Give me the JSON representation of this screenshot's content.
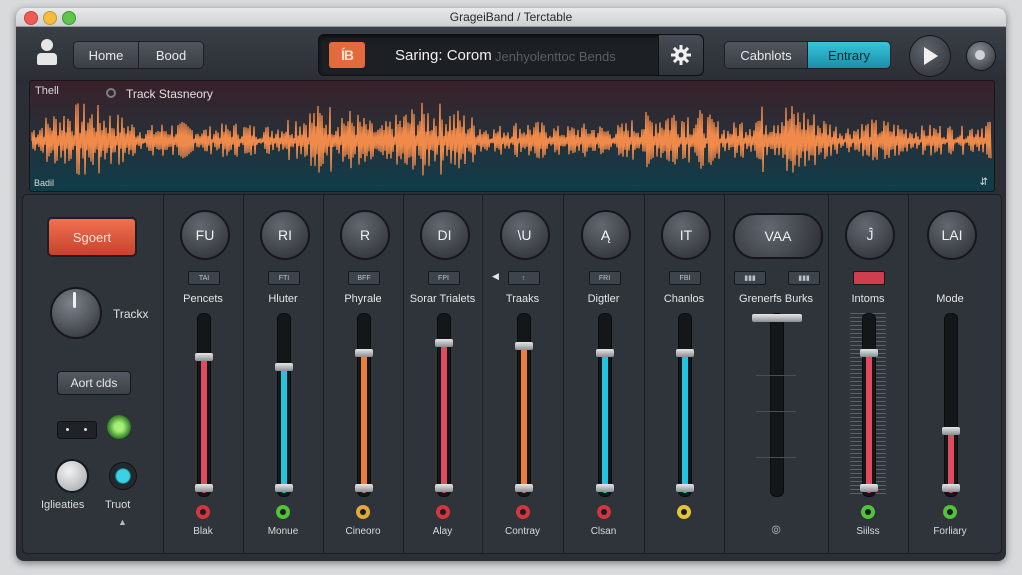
{
  "window": {
    "title": "GrageiBand / Terctable"
  },
  "toolbar": {
    "nav_tabs": [
      "Home",
      "Bood"
    ],
    "lcd": {
      "badge": "ÍB",
      "song": "Saring: Corom",
      "subtitle": "Jenhyolenttoc Bends"
    },
    "right_tabs": [
      "Cabnlots",
      "Entrary"
    ],
    "active_right_tab": "Entrary"
  },
  "waveform": {
    "tag": "Thell",
    "title": "Track Stasneory",
    "bottom_label": "Badil",
    "corner": "⇵"
  },
  "left_panel": {
    "red_button": "Sgoert",
    "knob_label": "Trackx",
    "gray_button": "Aort clds",
    "label_left": "Iglieaties",
    "label_right": "Truot"
  },
  "channels": [
    {
      "knob": "FU",
      "tag": "TAI",
      "name": "Pencets",
      "level": 0.78,
      "fill_color": "#e24a5e",
      "led_color": "#d3363e",
      "footer": "Blak"
    },
    {
      "knob": "RI",
      "tag": "FTI",
      "name": "Hluter",
      "level": 0.72,
      "fill_color": "#22c4e0",
      "led_color": "#53c23b",
      "footer": "Monue"
    },
    {
      "knob": "R",
      "tag": "BFF",
      "name": "Phyrale",
      "level": 0.8,
      "fill_color": "#ea7f3a",
      "led_color": "#e2a83a",
      "footer": "Cineoro"
    },
    {
      "knob": "DI",
      "tag": "FPI",
      "name": "Sorar Trialets",
      "level": 0.86,
      "fill_color": "#e24a5e",
      "led_color": "#d3363e",
      "footer": "Alay"
    },
    {
      "knob": "\\U",
      "tag": "↑",
      "name": "Traaks",
      "level": 0.84,
      "fill_color": "#ea7f3a",
      "led_color": "#d3363e",
      "footer": "Contray"
    },
    {
      "knob": "Ą",
      "tag": "FRI",
      "name": "Digtler",
      "level": 0.8,
      "fill_color": "#22c4e0",
      "led_color": "#d3363e",
      "footer": "Clsan"
    },
    {
      "knob": "IT",
      "tag": "FBI",
      "name": "Chanlos",
      "level": 0.8,
      "fill_color": "#22c4e0",
      "led_color": "#e6c43a",
      "footer": ""
    },
    {
      "knob": "VAA",
      "tag": "",
      "name": "Grenerfs Burks",
      "level": 0.0,
      "fill_color": "#22c4e0",
      "led_color": "",
      "footer": "",
      "footer_icon": "⦾"
    },
    {
      "knob": "Ĵ",
      "tag": "",
      "name": "Intoms",
      "level": 0.8,
      "fill_color": "#e24a5e",
      "led_color": "#53c23b",
      "footer": "Siilss"
    },
    {
      "knob": "LAI",
      "tag": "",
      "name": "Mode",
      "level": 0.36,
      "fill_color": "#e24a5e",
      "led_color": "#53c23b",
      "footer": "Forliary"
    }
  ]
}
